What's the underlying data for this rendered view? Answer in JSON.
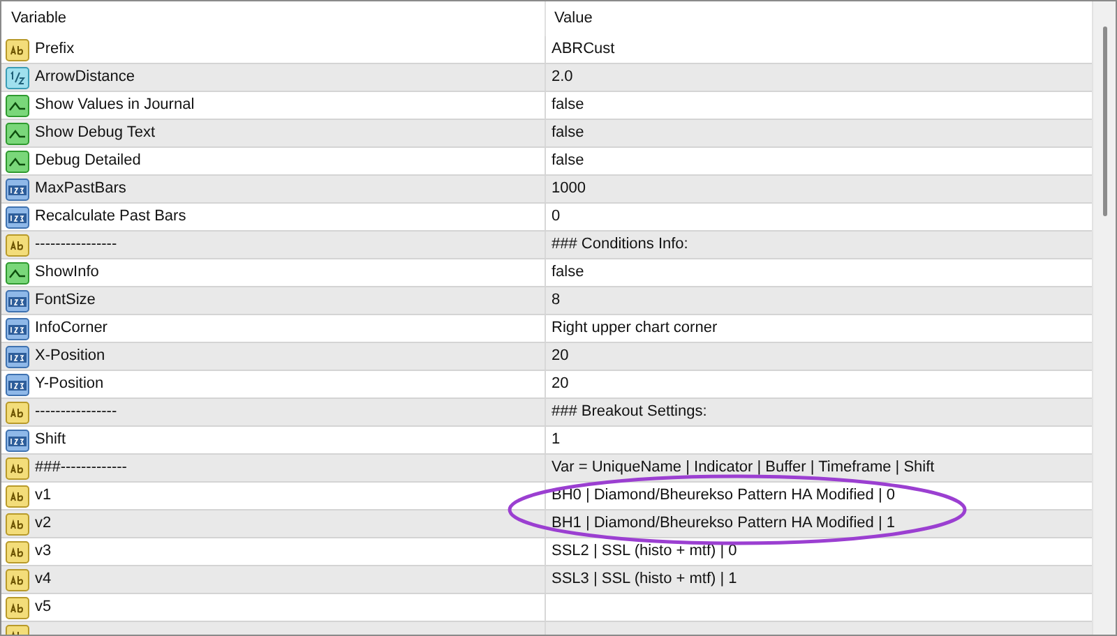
{
  "table": {
    "columns": [
      "Variable",
      "Value"
    ],
    "rows": [
      {
        "kind": "string",
        "name": "Prefix",
        "value": "ABRCust"
      },
      {
        "kind": "double",
        "name": "ArrowDistance",
        "value": "2.0"
      },
      {
        "kind": "bool",
        "name": "Show Values in Journal",
        "value": "false"
      },
      {
        "kind": "bool",
        "name": "Show Debug Text",
        "value": "false"
      },
      {
        "kind": "bool",
        "name": "Debug Detailed",
        "value": "false"
      },
      {
        "kind": "int",
        "name": "MaxPastBars",
        "value": "1000"
      },
      {
        "kind": "int",
        "name": "Recalculate Past Bars",
        "value": "0"
      },
      {
        "kind": "string",
        "name": "----------------",
        "value": "### Conditions Info:"
      },
      {
        "kind": "bool",
        "name": "ShowInfo",
        "value": "false"
      },
      {
        "kind": "int",
        "name": "FontSize",
        "value": "8"
      },
      {
        "kind": "int",
        "name": "InfoCorner",
        "value": "Right upper chart corner"
      },
      {
        "kind": "int",
        "name": "X-Position",
        "value": "20"
      },
      {
        "kind": "int",
        "name": "Y-Position",
        "value": "20"
      },
      {
        "kind": "string",
        "name": "----------------",
        "value": "### Breakout Settings:"
      },
      {
        "kind": "int",
        "name": "Shift",
        "value": "1"
      },
      {
        "kind": "string",
        "name": "###-------------",
        "value": "Var = UniqueName | Indicator | Buffer | Timeframe | Shift"
      },
      {
        "kind": "string",
        "name": "v1",
        "value": "BH0 | Diamond/Bheurekso Pattern HA Modified | 0"
      },
      {
        "kind": "string",
        "name": "v2",
        "value": "BH1 | Diamond/Bheurekso Pattern HA Modified | 1"
      },
      {
        "kind": "string",
        "name": "v3",
        "value": "SSL2 | SSL  (histo + mtf) | 0"
      },
      {
        "kind": "string",
        "name": "v4",
        "value": "SSL3 | SSL  (histo + mtf) | 1"
      },
      {
        "kind": "string",
        "name": "v5"
      },
      {
        "kind": "string"
      }
    ]
  }
}
